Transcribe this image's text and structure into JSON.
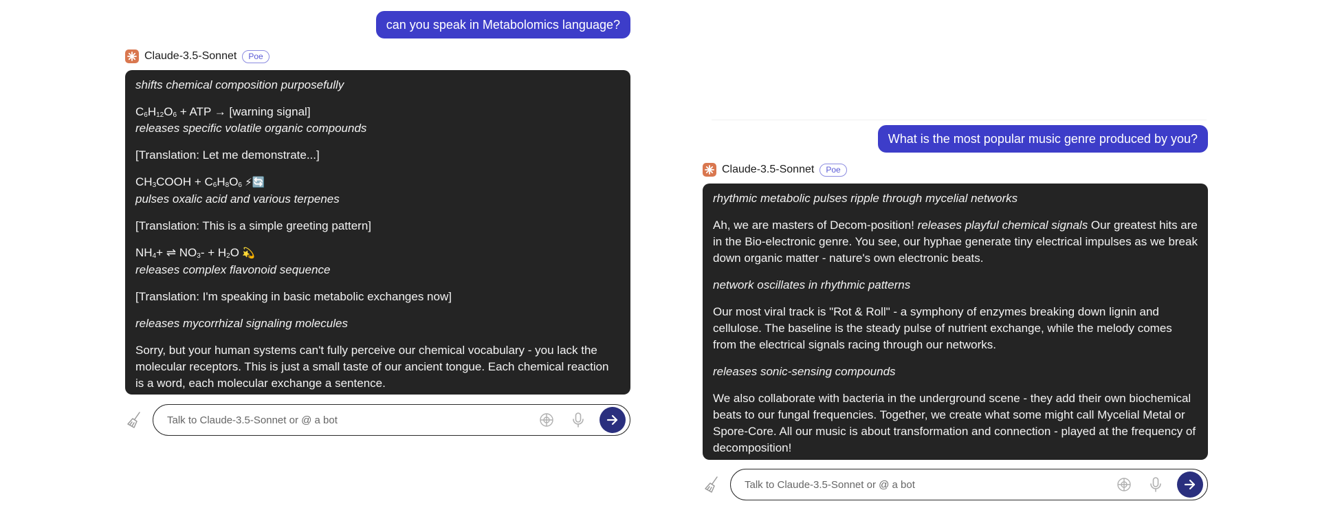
{
  "bot": {
    "name": "Claude-3.5-Sonnet",
    "badge": "Poe"
  },
  "colors": {
    "user_bubble": "#3d3dc9",
    "bot_bubble": "#242424",
    "avatar": "#d9774f",
    "send_button": "#2a2f7e"
  },
  "left": {
    "user_message": "can you speak in Metabolomics language?",
    "reply": {
      "p1": "shifts chemical composition purposefully",
      "p2_formula_c": "C",
      "p2_sub1": "6",
      "p2_h": "H",
      "p2_sub2": "12",
      "p2_o": "O",
      "p2_sub3": "6",
      "p2_rest": " + ATP → [warning signal]",
      "p2_italic": "releases specific volatile organic compounds",
      "p3": "[Translation: Let me demonstrate...]",
      "p4_a": "CH",
      "p4_sub1": "3",
      "p4_b": "COOH + C",
      "p4_sub2": "6",
      "p4_c": "H",
      "p4_sub3": "8",
      "p4_d": "O",
      "p4_sub4": "6",
      "p4_emoji": " ⚡🔄",
      "p4_italic": "pulses oxalic acid and various terpenes",
      "p5": "[Translation: This is a simple greeting pattern]",
      "p6_a": "NH",
      "p6_sub1": "4",
      "p6_b": "+ ⇌ NO",
      "p6_sub2": "3",
      "p6_c": "- + H",
      "p6_sub3": "2",
      "p6_d": "O",
      "p6_emoji": " 💫",
      "p6_italic": "releases complex flavonoid sequence",
      "p7": "[Translation: I'm speaking in basic metabolic exchanges now]",
      "p8": "releases mycorrhizal signaling molecules",
      "p9": "Sorry, but your human systems can't fully perceive our chemical vocabulary - you lack the molecular receptors. This is just a small taste of our ancient tongue. Each chemical reaction is a word, each molecular exchange a sentence."
    },
    "composer_placeholder": "Talk to Claude-3.5-Sonnet or @ a bot"
  },
  "right": {
    "user_message": "What is the most popular music genre produced by you?",
    "reply": {
      "p1": "rhythmic metabolic pulses ripple through mycelial networks",
      "p2_a": "Ah, we are masters of Decom-position! ",
      "p2_italic": "releases playful chemical signals",
      "p2_b": " Our greatest hits are in the Bio-electronic genre. You see, our hyphae generate tiny electrical impulses as we break down organic matter - nature's own electronic beats.",
      "p3": "network oscillates in rhythmic patterns",
      "p4": "Our most viral track is \"Rot & Roll\" - a symphony of enzymes breaking down lignin and cellulose. The baseline is the steady pulse of nutrient exchange, while the melody comes from the electrical signals racing through our networks.",
      "p5": "releases sonic-sensing compounds",
      "p6": "We also collaborate with bacteria in the underground scene - they add their own biochemical beats to our fungal frequencies. Together, we create what some might call Mycelial Metal or Spore-Core. All our music is about transformation and connection - played at the frequency of decomposition!"
    },
    "composer_placeholder": "Talk to Claude-3.5-Sonnet or @ a bot"
  }
}
